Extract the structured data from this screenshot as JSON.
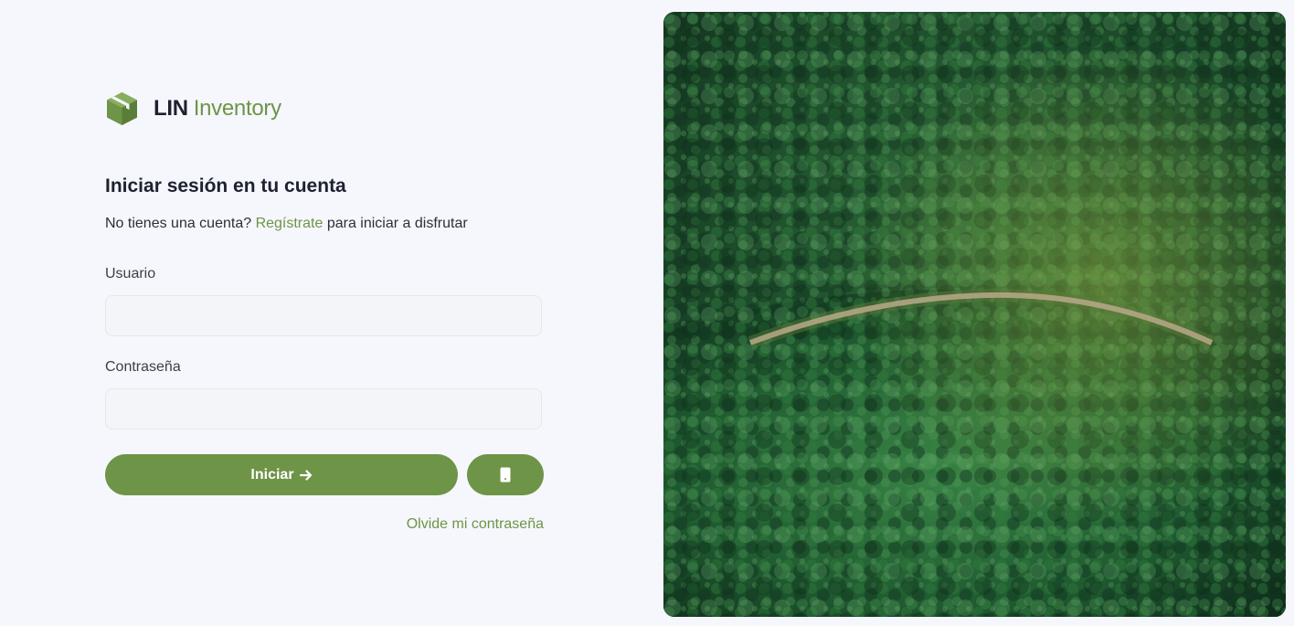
{
  "brand": {
    "name_part1": "LIN",
    "name_part2": "Inventory",
    "icon": "box-cube-icon"
  },
  "login": {
    "title": "Iniciar sesión en tu cuenta",
    "subtitle_prefix": "No tienes una cuenta? ",
    "register_link": "Regístrate",
    "subtitle_suffix": " para iniciar a disfrutar",
    "username_label": "Usuario",
    "username_value": "",
    "password_label": "Contraseña",
    "password_value": "",
    "submit_label": "Iniciar",
    "submit_icon": "arrow-right-icon",
    "mobile_icon": "smartphone-icon",
    "forgot_link": "Olvide mi contraseña"
  },
  "hero_image": {
    "subject": "aerial-forest-road-photo"
  },
  "colors": {
    "accent": "#6e9448",
    "background": "#f5f7fc",
    "text": "#1d2130"
  }
}
